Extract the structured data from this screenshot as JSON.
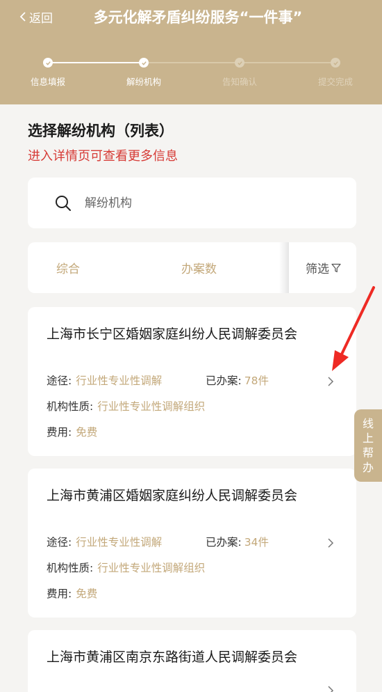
{
  "header": {
    "back_label": "返回",
    "title": "多元化解矛盾纠纷服务“一件事”",
    "bg_color": "#c9b48e"
  },
  "steps": [
    {
      "label": "信息填报",
      "state": "done"
    },
    {
      "label": "解纷机构",
      "state": "active"
    },
    {
      "label": "告知确认",
      "state": "pending"
    },
    {
      "label": "提交完成",
      "state": "pending"
    }
  ],
  "section": {
    "title": "选择解纷机构（列表）",
    "hint": "进入详情页可查看更多信息"
  },
  "search": {
    "placeholder": "解纷机构",
    "value": ""
  },
  "sort": {
    "items": [
      "综合",
      "办案数"
    ],
    "filter_label": "筛选"
  },
  "field_labels": {
    "route": "途径:",
    "cases": "已办案:",
    "nature": "机构性质:",
    "fee": "费用:"
  },
  "cards": [
    {
      "name": "上海市长宁区婚姻家庭纠纷人民调解委员会",
      "route": "行业性专业性调解",
      "cases": "78件",
      "nature": "行业性专业性调解组织",
      "fee": "免费"
    },
    {
      "name": "上海市黄浦区婚姻家庭纠纷人民调解委员会",
      "route": "行业性专业性调解",
      "cases": "34件",
      "nature": "行业性专业性调解组织",
      "fee": "免费"
    },
    {
      "name": "上海市黄浦区南京东路街道人民调解委员会"
    }
  ],
  "help": {
    "label": "线上帮办"
  },
  "colors": {
    "accent": "#c3a87a",
    "hint_red": "#d63a35",
    "annotation_arrow": "#ee2a24"
  }
}
